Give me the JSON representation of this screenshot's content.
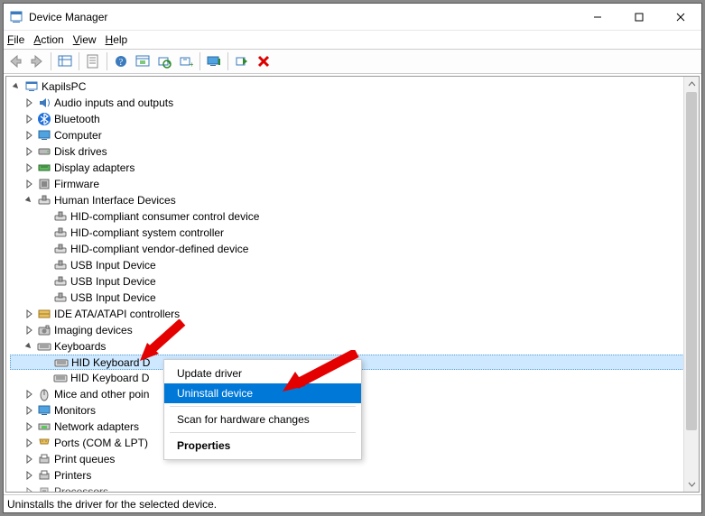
{
  "window": {
    "title": "Device Manager",
    "caption_buttons": {
      "min": "Minimize",
      "max": "Maximize",
      "close": "Close"
    }
  },
  "menubar": {
    "file": "File",
    "action": "Action",
    "view": "View",
    "help": "Help"
  },
  "toolbar": {
    "back": "Back",
    "forward": "Forward",
    "show_hidden": "Show hidden devices",
    "properties": "Properties",
    "help": "Help",
    "update": "Update driver",
    "scan": "Scan for hardware changes",
    "add_legacy": "Add legacy hardware",
    "monitor": "Devices by connection",
    "enable": "Enable device",
    "uninstall": "Uninstall device"
  },
  "tree": {
    "root": "KapilsPC",
    "nodes": {
      "audio": "Audio inputs and outputs",
      "bluetooth": "Bluetooth",
      "computer": "Computer",
      "diskdrives": "Disk drives",
      "display": "Display adapters",
      "firmware": "Firmware",
      "hid": "Human Interface Devices",
      "hid_children": [
        "HID-compliant consumer control device",
        "HID-compliant system controller",
        "HID-compliant vendor-defined device",
        "USB Input Device",
        "USB Input Device",
        "USB Input Device"
      ],
      "ide": "IDE ATA/ATAPI controllers",
      "imaging": "Imaging devices",
      "keyboards": "Keyboards",
      "keyboards_children": [
        "HID Keyboard Device",
        "HID Keyboard Device"
      ],
      "mice": "Mice and other pointing devices",
      "monitors": "Monitors",
      "network": "Network adapters",
      "ports": "Ports (COM & LPT)",
      "printqueues": "Print queues",
      "printers": "Printers",
      "processors": "Processors"
    }
  },
  "context_menu": {
    "update": "Update driver",
    "uninstall": "Uninstall device",
    "scan": "Scan for hardware changes",
    "properties": "Properties"
  },
  "statusbar": {
    "text": "Uninstalls the driver for the selected device."
  }
}
